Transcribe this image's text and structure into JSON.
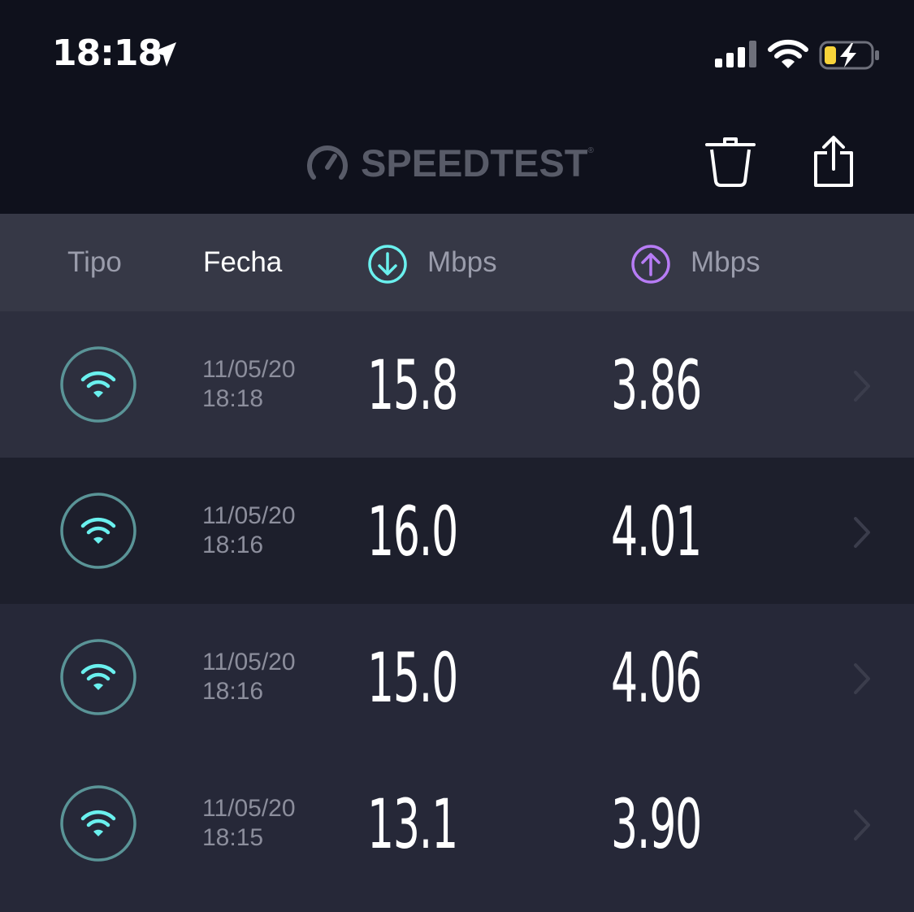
{
  "status_bar": {
    "time": "18:18",
    "icons": [
      "location-arrow-icon",
      "cellular-signal-icon",
      "wifi-icon",
      "battery-charging-icon"
    ]
  },
  "nav": {
    "logo_text": "SPEEDTEST",
    "logo_tm": "®",
    "actions": [
      "trash-icon",
      "share-icon"
    ]
  },
  "header": {
    "tipo": "Tipo",
    "fecha": "Fecha",
    "download_unit": "Mbps",
    "upload_unit": "Mbps"
  },
  "results": [
    {
      "type_icon": "wifi-icon",
      "date": "11/05/20",
      "time": "18:18",
      "download": "15.8",
      "upload": "3.86"
    },
    {
      "type_icon": "wifi-icon",
      "date": "11/05/20",
      "time": "18:16",
      "download": "16.0",
      "upload": "4.01"
    },
    {
      "type_icon": "wifi-icon",
      "date": "11/05/20",
      "time": "18:16",
      "download": "15.0",
      "upload": "4.06"
    },
    {
      "type_icon": "wifi-icon",
      "date": "11/05/20",
      "time": "18:15",
      "download": "13.1",
      "upload": "3.90"
    }
  ],
  "colors": {
    "background": "#262838",
    "topbar": "#0f111c",
    "header": "#363846",
    "wifi_accent": "#6af0ee",
    "download_accent": "#6af0ee",
    "upload_accent": "#b77cf5",
    "logo": "#585b68"
  }
}
